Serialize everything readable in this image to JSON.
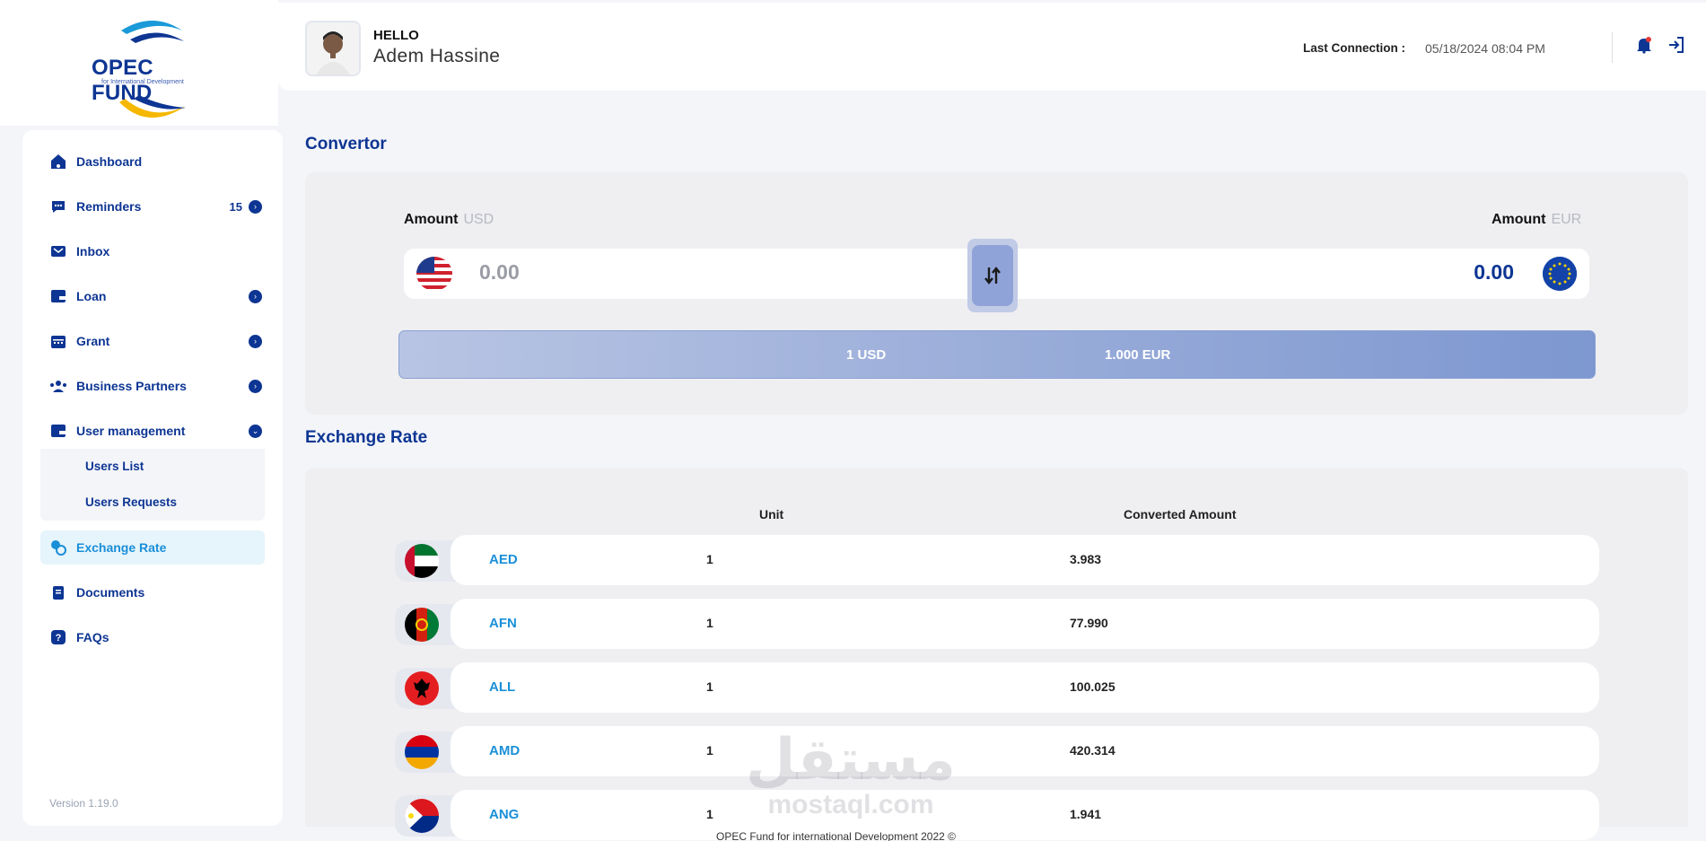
{
  "brand": {
    "name": "OPEC FUND",
    "subtitle": "for International Development"
  },
  "sidebar": {
    "items": [
      {
        "label": "Dashboard",
        "icon": "home-icon"
      },
      {
        "label": "Reminders",
        "icon": "chat-icon",
        "count": "15",
        "arrow": "›"
      },
      {
        "label": "Inbox",
        "icon": "mail-icon"
      },
      {
        "label": "Loan",
        "icon": "wallet-icon",
        "arrow": "›"
      },
      {
        "label": "Grant",
        "icon": "calendar-icon",
        "arrow": "›"
      },
      {
        "label": "Business Partners",
        "icon": "partners-icon",
        "arrow": "›"
      },
      {
        "label": "User management",
        "icon": "wallet-icon",
        "arrow": "⌄"
      },
      {
        "label": "Exchange Rate",
        "icon": "exchange-icon",
        "active": true
      },
      {
        "label": "Documents",
        "icon": "documents-icon"
      },
      {
        "label": "FAQs",
        "icon": "help-icon"
      }
    ],
    "sub_items": [
      "Users List",
      "Users Requests"
    ],
    "version": "Version 1.19.0"
  },
  "header": {
    "greeting": "HELLO",
    "user_name": "Adem  Hassine",
    "last_connection_label": "Last Connection :",
    "last_connection_value": "05/18/2024 08:04 PM"
  },
  "convertor": {
    "title": "Convertor",
    "amount_label": "Amount",
    "from_currency": "USD",
    "to_currency": "EUR",
    "from_value": "0.00",
    "to_value": "0.00",
    "rate_from": "1 USD",
    "rate_to": "1.000 EUR"
  },
  "exchange": {
    "title": "Exchange Rate",
    "col_unit": "Unit",
    "col_converted": "Converted Amount",
    "rows": [
      {
        "code": "AED",
        "unit": "1",
        "value": "3.983"
      },
      {
        "code": "AFN",
        "unit": "1",
        "value": "77.990"
      },
      {
        "code": "ALL",
        "unit": "1",
        "value": "100.025"
      },
      {
        "code": "AMD",
        "unit": "1",
        "value": "420.314"
      },
      {
        "code": "ANG",
        "unit": "1",
        "value": "1.941"
      }
    ]
  },
  "footer": "OPEC Fund for international Development 2022 ©",
  "watermark": {
    "arabic": "مستقل",
    "latin": "mostaql.com"
  },
  "colors": {
    "primary": "#0d3593",
    "accent": "#1a8fd8",
    "panel": "#efeff2",
    "background": "#f4f5f9"
  }
}
